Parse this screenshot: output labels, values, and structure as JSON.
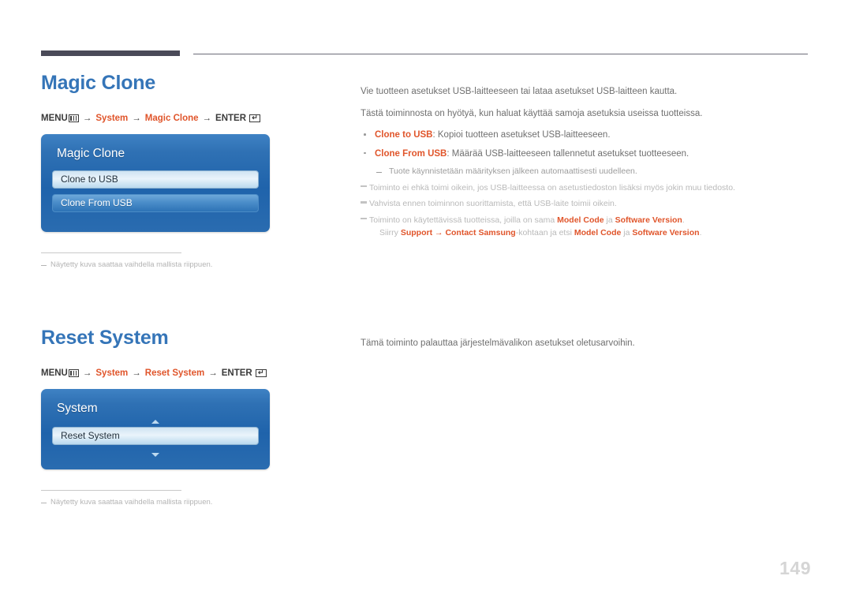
{
  "page": {
    "number": "149"
  },
  "sections": [
    {
      "title": "Magic Clone",
      "breadcrumb": {
        "menu_label": "MENU",
        "menu_icon": "menu-grid-icon",
        "arrow": "→",
        "crumb1": "System",
        "crumb2": "Magic Clone",
        "enter_label": "ENTER",
        "enter_icon": "enter-return-icon",
        "enter_glyph": "↵"
      },
      "osd": {
        "title": "Magic Clone",
        "items": [
          {
            "label": "Clone to USB",
            "state": "selected"
          },
          {
            "label": "Clone From USB",
            "state": "normal"
          }
        ]
      },
      "footnote": {
        "dash": "–",
        "text": "Näytetty kuva saattaa vaihdella mallista riippuen."
      },
      "body": {
        "paragraphs": [
          "Vie tuotteen asetukset USB-laitteeseen tai lataa asetukset USB-laitteen kautta.",
          "Tästä toiminnosta on hyötyä, kun haluat käyttää samoja asetuksia useissa tuotteissa."
        ],
        "bullets": [
          {
            "term": "Clone to USB",
            "rest": ": Kopioi tuotteen asetukset USB-laitteeseen."
          },
          {
            "term": "Clone From USB",
            "rest": ": Määrää USB-laitteeseen tallennetut asetukset tuotteeseen."
          }
        ],
        "sub_note": {
          "dash": "–",
          "text": "Tuote käynnistetään määrityksen jälkeen automaattisesti uudelleen."
        },
        "notes": [
          {
            "text": "Toiminto ei ehkä toimi oikein, jos USB-laitteessa on asetustiedoston lisäksi myös jokin muu tiedosto."
          },
          {
            "text": "Vahvista ennen toiminnon suorittamista, että USB-laite toimii oikein."
          }
        ],
        "note_rich": {
          "line1_pre": "Toiminto on käytettävissä tuotteissa, joilla on sama ",
          "line1_b1": "Model Code",
          "line1_mid": " ja ",
          "line1_b2": "Software Version",
          "line1_end": ".",
          "line2_pre": "Siirry ",
          "line2_b1": "Support",
          "line2_arrow": " → ",
          "line2_b2": "Contact Samsung",
          "line2_mid": "-kohtaan ja etsi ",
          "line2_b3": "Model Code",
          "line2_mid2": " ja ",
          "line2_b4": "Software Version",
          "line2_end": "."
        }
      }
    },
    {
      "title": "Reset System",
      "breadcrumb": {
        "menu_label": "MENU",
        "menu_icon": "menu-grid-icon",
        "arrow": "→",
        "crumb1": "System",
        "crumb2": "Reset System",
        "enter_label": "ENTER",
        "enter_icon": "enter-return-icon",
        "enter_glyph": "↵"
      },
      "osd": {
        "title": "System",
        "scroll_up_icon": "triangle-up-icon",
        "scroll_down_icon": "triangle-down-icon",
        "items": [
          {
            "label": "Reset System",
            "state": "selected"
          }
        ]
      },
      "footnote": {
        "dash": "–",
        "text": "Näytetty kuva saattaa vaihdella mallista riippuen."
      },
      "body": {
        "paragraphs": [
          "Tämä toiminto palauttaa järjestelmävalikon asetukset oletusarvoihin."
        ]
      }
    }
  ],
  "colors": {
    "title_blue": "#3575b8",
    "accent_orange": "#e0552b",
    "rule_dark": "#4a4a58",
    "body_gray": "#6f6f6f",
    "note_gray": "#b9b9b9",
    "page_number_gray": "#d5d5d5"
  }
}
